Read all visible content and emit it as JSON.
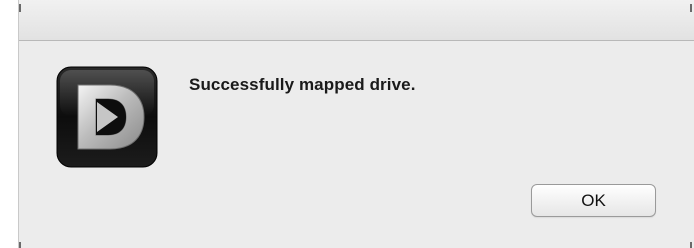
{
  "dialog": {
    "message": "Successfully mapped drive.",
    "ok_label": "OK",
    "icon": "dlink-d-logo-icon"
  },
  "colors": {
    "window_bg": "#ececec",
    "titlebar_top": "#f1f1f1",
    "titlebar_bottom": "#e2e2e2",
    "text": "#1a1a1a",
    "icon_bg": "#111111",
    "icon_letter": "#d9d9d9"
  }
}
